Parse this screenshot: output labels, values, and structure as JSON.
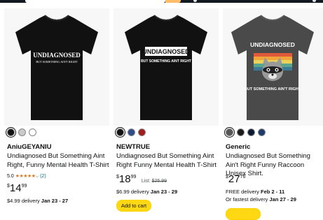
{
  "products": [
    {
      "brand": "AniuGEYANIU",
      "title": "Undiagnosed But Something Aint Right, Funny Mental Health T-Shirt",
      "shirt_text": "UNDIAGNOSED",
      "shirt_subtext": "BUT SOMETHING AIN'T RIGHT",
      "rating_value": "5.0",
      "stars_glyph": "★★★★★",
      "rating_count": "(2)",
      "price_symbol": "$",
      "price_whole": "14",
      "price_fraction": "99",
      "delivery_line1_prefix": "$4.99 delivery",
      "delivery_line1_date": "Jan 23 - 27",
      "swatch_colors": [
        "#111111",
        "#c9c9c9",
        "#ffffff"
      ]
    },
    {
      "brand": "NEWTRUE",
      "title": "Undiagnosed But Something Aint Right Funny Mental Health T-Shirt",
      "shirt_text": "UNDIAGNOSED",
      "shirt_subtext": "BUT SOMETHING AINT RIGHT",
      "price_symbol": "$",
      "price_whole": "18",
      "price_fraction": "99",
      "list_label": "List:",
      "list_price": "$25.99",
      "delivery_line1_prefix": "$6.99 delivery",
      "delivery_line1_date": "Jan 23 - 29",
      "cart_label": "Add to cart",
      "swatch_colors": [
        "#111111",
        "#2d4e8a",
        "#a31c1c"
      ]
    },
    {
      "brand": "Generic",
      "title": "Undiagnosed But Something Ain't Right Funny Raccoon Unisex Shirt.",
      "shirt_text": "UNDIAGNOSED",
      "shirt_subtext": "BUT SOMETHING AIN'T RIGHT",
      "price_symbol": "$",
      "price_whole": "27",
      "price_fraction": "76",
      "delivery_line1_prefix": "FREE delivery",
      "delivery_line1_date": "Feb 2 - 11",
      "delivery_line2_prefix": "Or fastest delivery",
      "delivery_line2_date": "Jan 27 - 29",
      "swatch_colors": [
        "#555555",
        "#1b1b1b",
        "#0b1a33",
        "#1f3b6b"
      ]
    }
  ],
  "colors": {
    "header_bg": "#131921",
    "search_button": "#febd69",
    "cart_button": "#ffd814",
    "link": "#007185",
    "star": "#de7921"
  }
}
